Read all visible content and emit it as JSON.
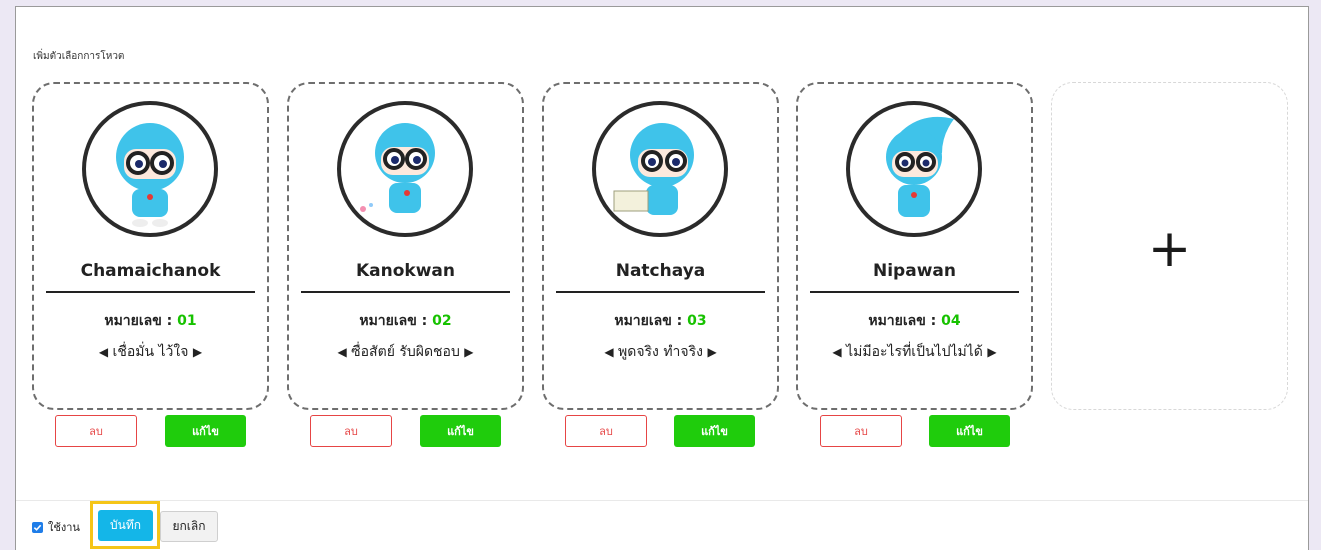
{
  "section": {
    "title": "เพิ่มตัวเลือกการโหวต"
  },
  "number_label": "หมายเลข : ",
  "arrows": {
    "left": "◀",
    "right": "▶"
  },
  "candidates": [
    {
      "name": "Chamaichanok",
      "number": "01",
      "slogan": "เชื่อมั่น ไว้ใจ",
      "delete_label": "ลบ",
      "edit_label": "แก้ไข"
    },
    {
      "name": "Kanokwan",
      "number": "02",
      "slogan": "ซื่อสัตย์ รับผิดชอบ",
      "delete_label": "ลบ",
      "edit_label": "แก้ไข"
    },
    {
      "name": "Natchaya",
      "number": "03",
      "slogan": "พูดจริง ทำจริง",
      "delete_label": "ลบ",
      "edit_label": "แก้ไข"
    },
    {
      "name": "Nipawan",
      "number": "04",
      "slogan": "ไม่มีอะไรที่เป็นไปไม่ได้",
      "delete_label": "ลบ",
      "edit_label": "แก้ไข"
    }
  ],
  "add_card": {
    "symbol": "+"
  },
  "footer": {
    "active_label": "ใช้งาน",
    "active_checked": true,
    "save_label": "บันทึก",
    "cancel_label": "ยกเลิก"
  },
  "colors": {
    "number": "#17c200",
    "edit_button": "#1fcc0c",
    "delete_button": "#e64545",
    "save_button": "#14b6e8",
    "highlight": "#f5c518",
    "mascot": "#3fc3ea"
  }
}
